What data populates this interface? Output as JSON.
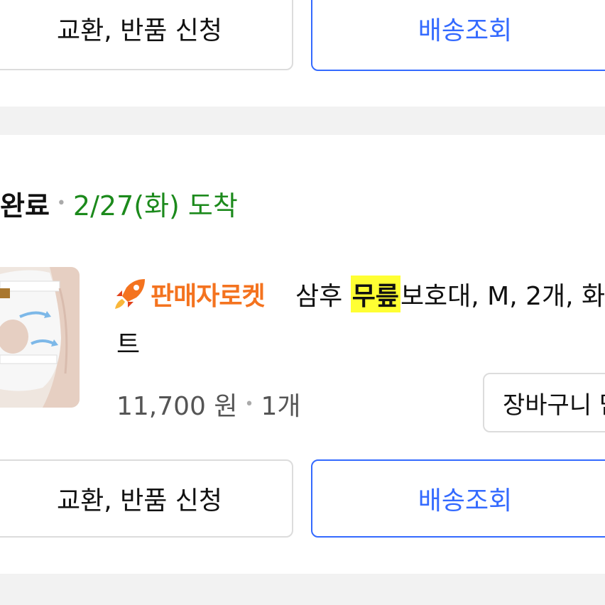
{
  "top_actions": {
    "exchange_return_label": "교환, 반품 신청",
    "track_delivery_label": "배송조회"
  },
  "order": {
    "status_label": "완료",
    "arrival_text": "2/27(화) 도착",
    "item": {
      "badge_text": "판매자로켓",
      "title_before_highlight": "삼후 ",
      "title_highlight": "무릎",
      "title_after_highlight": "보호대, M, 2개, 화",
      "title_line2": "트",
      "price": "11,700 원",
      "quantity": "1개",
      "cart_button_label": "장바구니 담"
    },
    "actions": {
      "exchange_return_label": "교환, 반품 신청",
      "track_delivery_label": "배송조회"
    }
  },
  "colors": {
    "primary": "#346aff",
    "arrival": "#1c8a1c",
    "badge": "#f4731f",
    "highlight": "#ffff33"
  }
}
